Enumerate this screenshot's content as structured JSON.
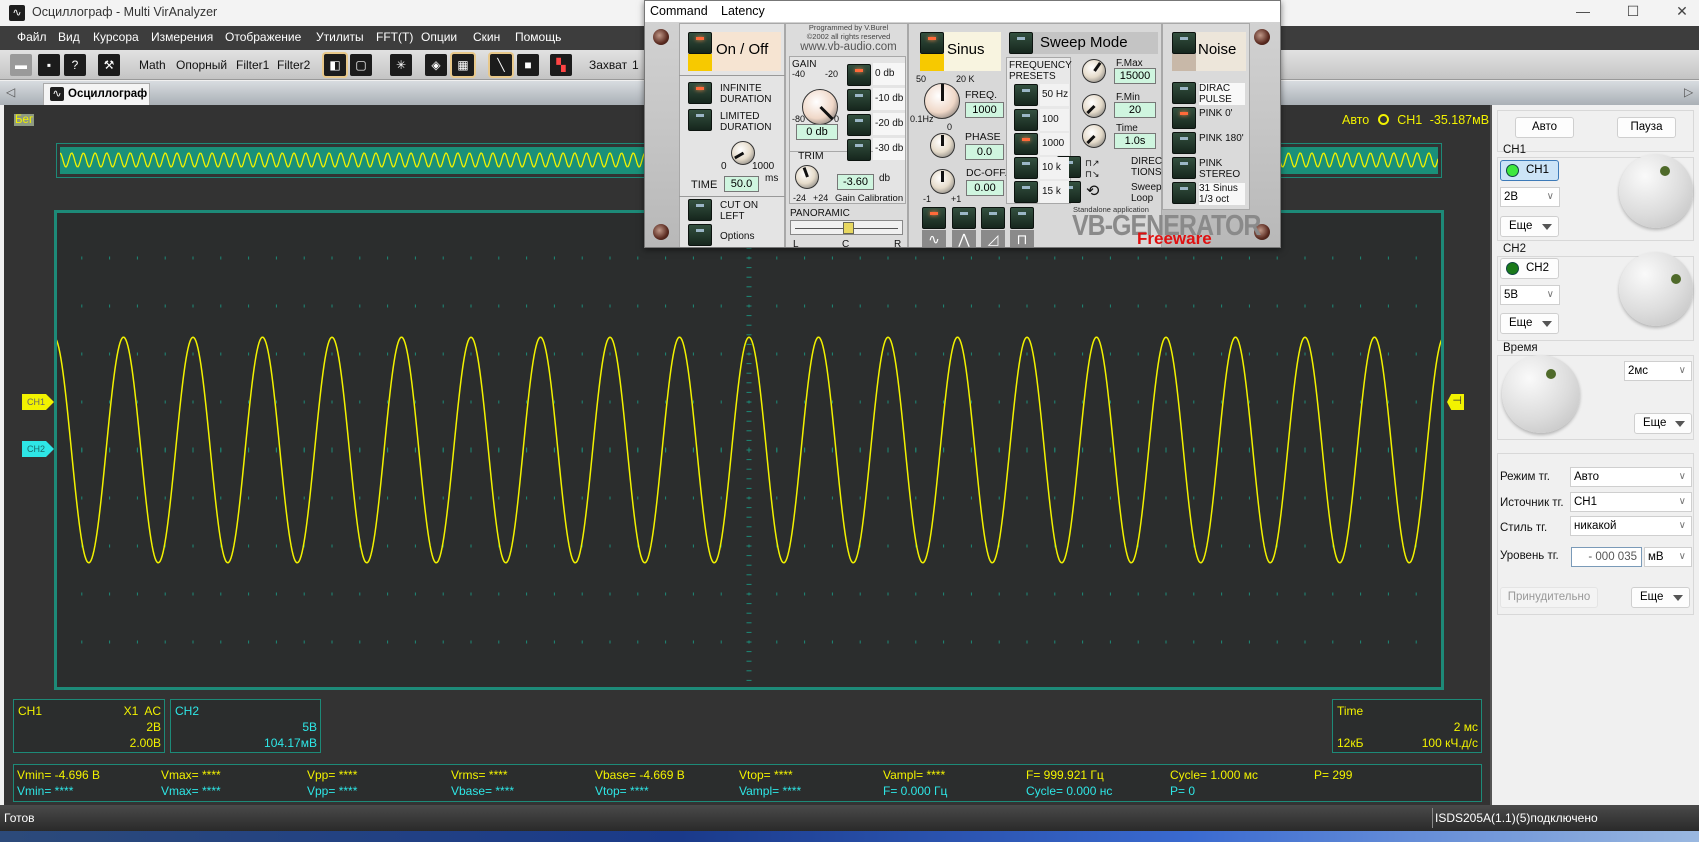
{
  "window": {
    "title": "Осциллограф - Multi VirAnalyzer",
    "app_icon": "oscilloscope-icon",
    "controls": [
      "minimize",
      "maximize",
      "close"
    ]
  },
  "menu": [
    "Файл",
    "Вид",
    "Курсора",
    "Измерения",
    "Отображение",
    "Утилиты",
    "FFT(T)",
    "Опции",
    "Скин",
    "Помощь"
  ],
  "toolbar": {
    "math": "Math",
    "reference": "Опорный",
    "filter1": "Filter1",
    "filter2": "Filter2",
    "capture": "Захват",
    "capture_value": "1"
  },
  "tab": {
    "label": "Осциллограф"
  },
  "scope": {
    "run_state": "Бег",
    "trigger_status": {
      "mode": "Авто",
      "source": "CH1",
      "level": "-35.187мВ"
    },
    "ch1_marker": "CH1",
    "ch2_marker": "CH2",
    "colors": {
      "ch1": "#f2f200",
      "ch2": "#2ee6e6",
      "frame": "#1d8a78",
      "background": "#2b2d2d"
    }
  },
  "chart_data": {
    "type": "line",
    "x_divisions": 10,
    "y_divisions": 10,
    "timebase_ms_per_div": 2,
    "volts_per_div": 2,
    "series": [
      {
        "name": "CH1",
        "waveform": "sine",
        "frequency_hz": 1000,
        "amplitude_v": 4.7,
        "start_phase": "peak"
      }
    ],
    "grid": true
  },
  "ch1_info": {
    "label": "CH1",
    "probe": "X1",
    "coupling": "AC",
    "scale": "2В",
    "offset": "2.00В"
  },
  "ch2_info": {
    "label": "CH2",
    "scale": "5В",
    "offset": "104.17мВ"
  },
  "time_info": {
    "label": "Time",
    "scale": "2 мс",
    "memory": "12кБ",
    "rate": "100 кЧ.д/с"
  },
  "measurements": {
    "ch1": [
      "Vmin= -4.696 В",
      "Vmax= ****",
      "Vpp= ****",
      "Vrms= ****",
      "Vbase= -4.669 В",
      "Vtop= ****",
      "Vampl= ****",
      "F= 999.921 Гц",
      "Cycle= 1.000 мс",
      "P= 299"
    ],
    "ch2": [
      "Vmin= ****",
      "Vmax= ****",
      "Vpp= ****",
      "Vbase= ****",
      "Vtop= ****",
      "Vampl= ****",
      "F= 0.000 Гц",
      "Cycle= 0.000 нс",
      "P= 0"
    ]
  },
  "right_panel": {
    "auto": "Авто",
    "pause": "Пауза",
    "ch1": {
      "group": "CH1",
      "toggle": "CH1",
      "scale": "2В",
      "more": "Еще"
    },
    "ch2": {
      "group": "CH2",
      "toggle": "CH2",
      "scale": "5В",
      "more": "Еще"
    },
    "time": {
      "group": "Время",
      "scale": "2мс",
      "more": "Еще"
    },
    "trigger": {
      "mode_label": "Режим тг.",
      "mode": "Авто",
      "source_label": "Источник тг.",
      "source": "CH1",
      "style_label": "Стиль тг.",
      "style": "никакой",
      "level_label": "Уровень тг.",
      "level": "- 000 035",
      "level_unit": "мВ",
      "force": "Принудительно",
      "more": "Еще"
    }
  },
  "status": {
    "left": "Готов",
    "right": "ISDS205A(1.1)(5)подключено"
  },
  "generator": {
    "menu": [
      "Command",
      "Latency"
    ],
    "on_off": "On / Off",
    "infinite": [
      "INFINITE",
      "DURATION"
    ],
    "limited": [
      "LIMITED",
      "DURATION"
    ],
    "time_min": "0",
    "time_max": "1000",
    "time_label": "TIME",
    "time_value": "50.0",
    "time_unit": "ms",
    "cut_on_left": [
      "CUT ON",
      "LEFT"
    ],
    "options": "Options",
    "credit1": "Programmed by V.Burel",
    "credit2": "©2002 all rights reserved",
    "url": "www.vb-audio.com",
    "gain": {
      "label": "GAIN",
      "m40": "-40",
      "m20": "-20",
      "m80": "-80",
      "zero": "0",
      "value": "0 db",
      "presets": [
        "0 db",
        "-10 db",
        "-20 db",
        "-30 db"
      ],
      "active_preset": 0
    },
    "trim": {
      "label": "TRIM",
      "value": "-3.60",
      "unit": "db",
      "min": "-24",
      "max": "+24",
      "caption": "Gain Calibration"
    },
    "panoramic": {
      "label": "PANORAMIC",
      "l": "L",
      "c": "C",
      "r": "R",
      "position": 0.5
    },
    "sinus": "Sinus",
    "sweep_mode": "Sweep Mode",
    "noise": "Noise",
    "freq": {
      "label": "FREQ.",
      "value": "1000",
      "s50": "50",
      "s20k": "20 K",
      "s01": "0.1Hz"
    },
    "phase": {
      "label": "PHASE",
      "value": "0.0",
      "zero": "0"
    },
    "dcoff": {
      "label": "DC-OFF.",
      "value": "0.00",
      "min": "-1",
      "max": "+1"
    },
    "presets_label": [
      "FREQUENCY",
      "PRESETS"
    ],
    "presets": [
      "50 Hz",
      "100",
      "1000",
      "10 k",
      "15 k"
    ],
    "active_freq_preset": 2,
    "fmax": {
      "label": "F.Max",
      "value": "15000"
    },
    "fmin": {
      "label": "F.Min",
      "value": "20"
    },
    "stime": {
      "label": "Time",
      "value": "1.0s"
    },
    "directions": [
      "DIREC",
      "TIONS"
    ],
    "sweep_loop": [
      "Sweep",
      "Loop"
    ],
    "noise_types": [
      [
        "DIRAC",
        "PULSE"
      ],
      [
        "PINK 0'",
        ""
      ],
      [
        "PINK 180'",
        ""
      ],
      [
        "PINK",
        "STEREO"
      ],
      [
        "31 Sinus",
        "1/3 oct"
      ]
    ],
    "active_noise": 1,
    "waveforms": [
      "sine",
      "triangle",
      "sawtooth",
      "square"
    ],
    "active_waveform": 0,
    "standalone": "Standalone application",
    "brand": "VB-GENERATOR",
    "freeware": "Freeware"
  }
}
